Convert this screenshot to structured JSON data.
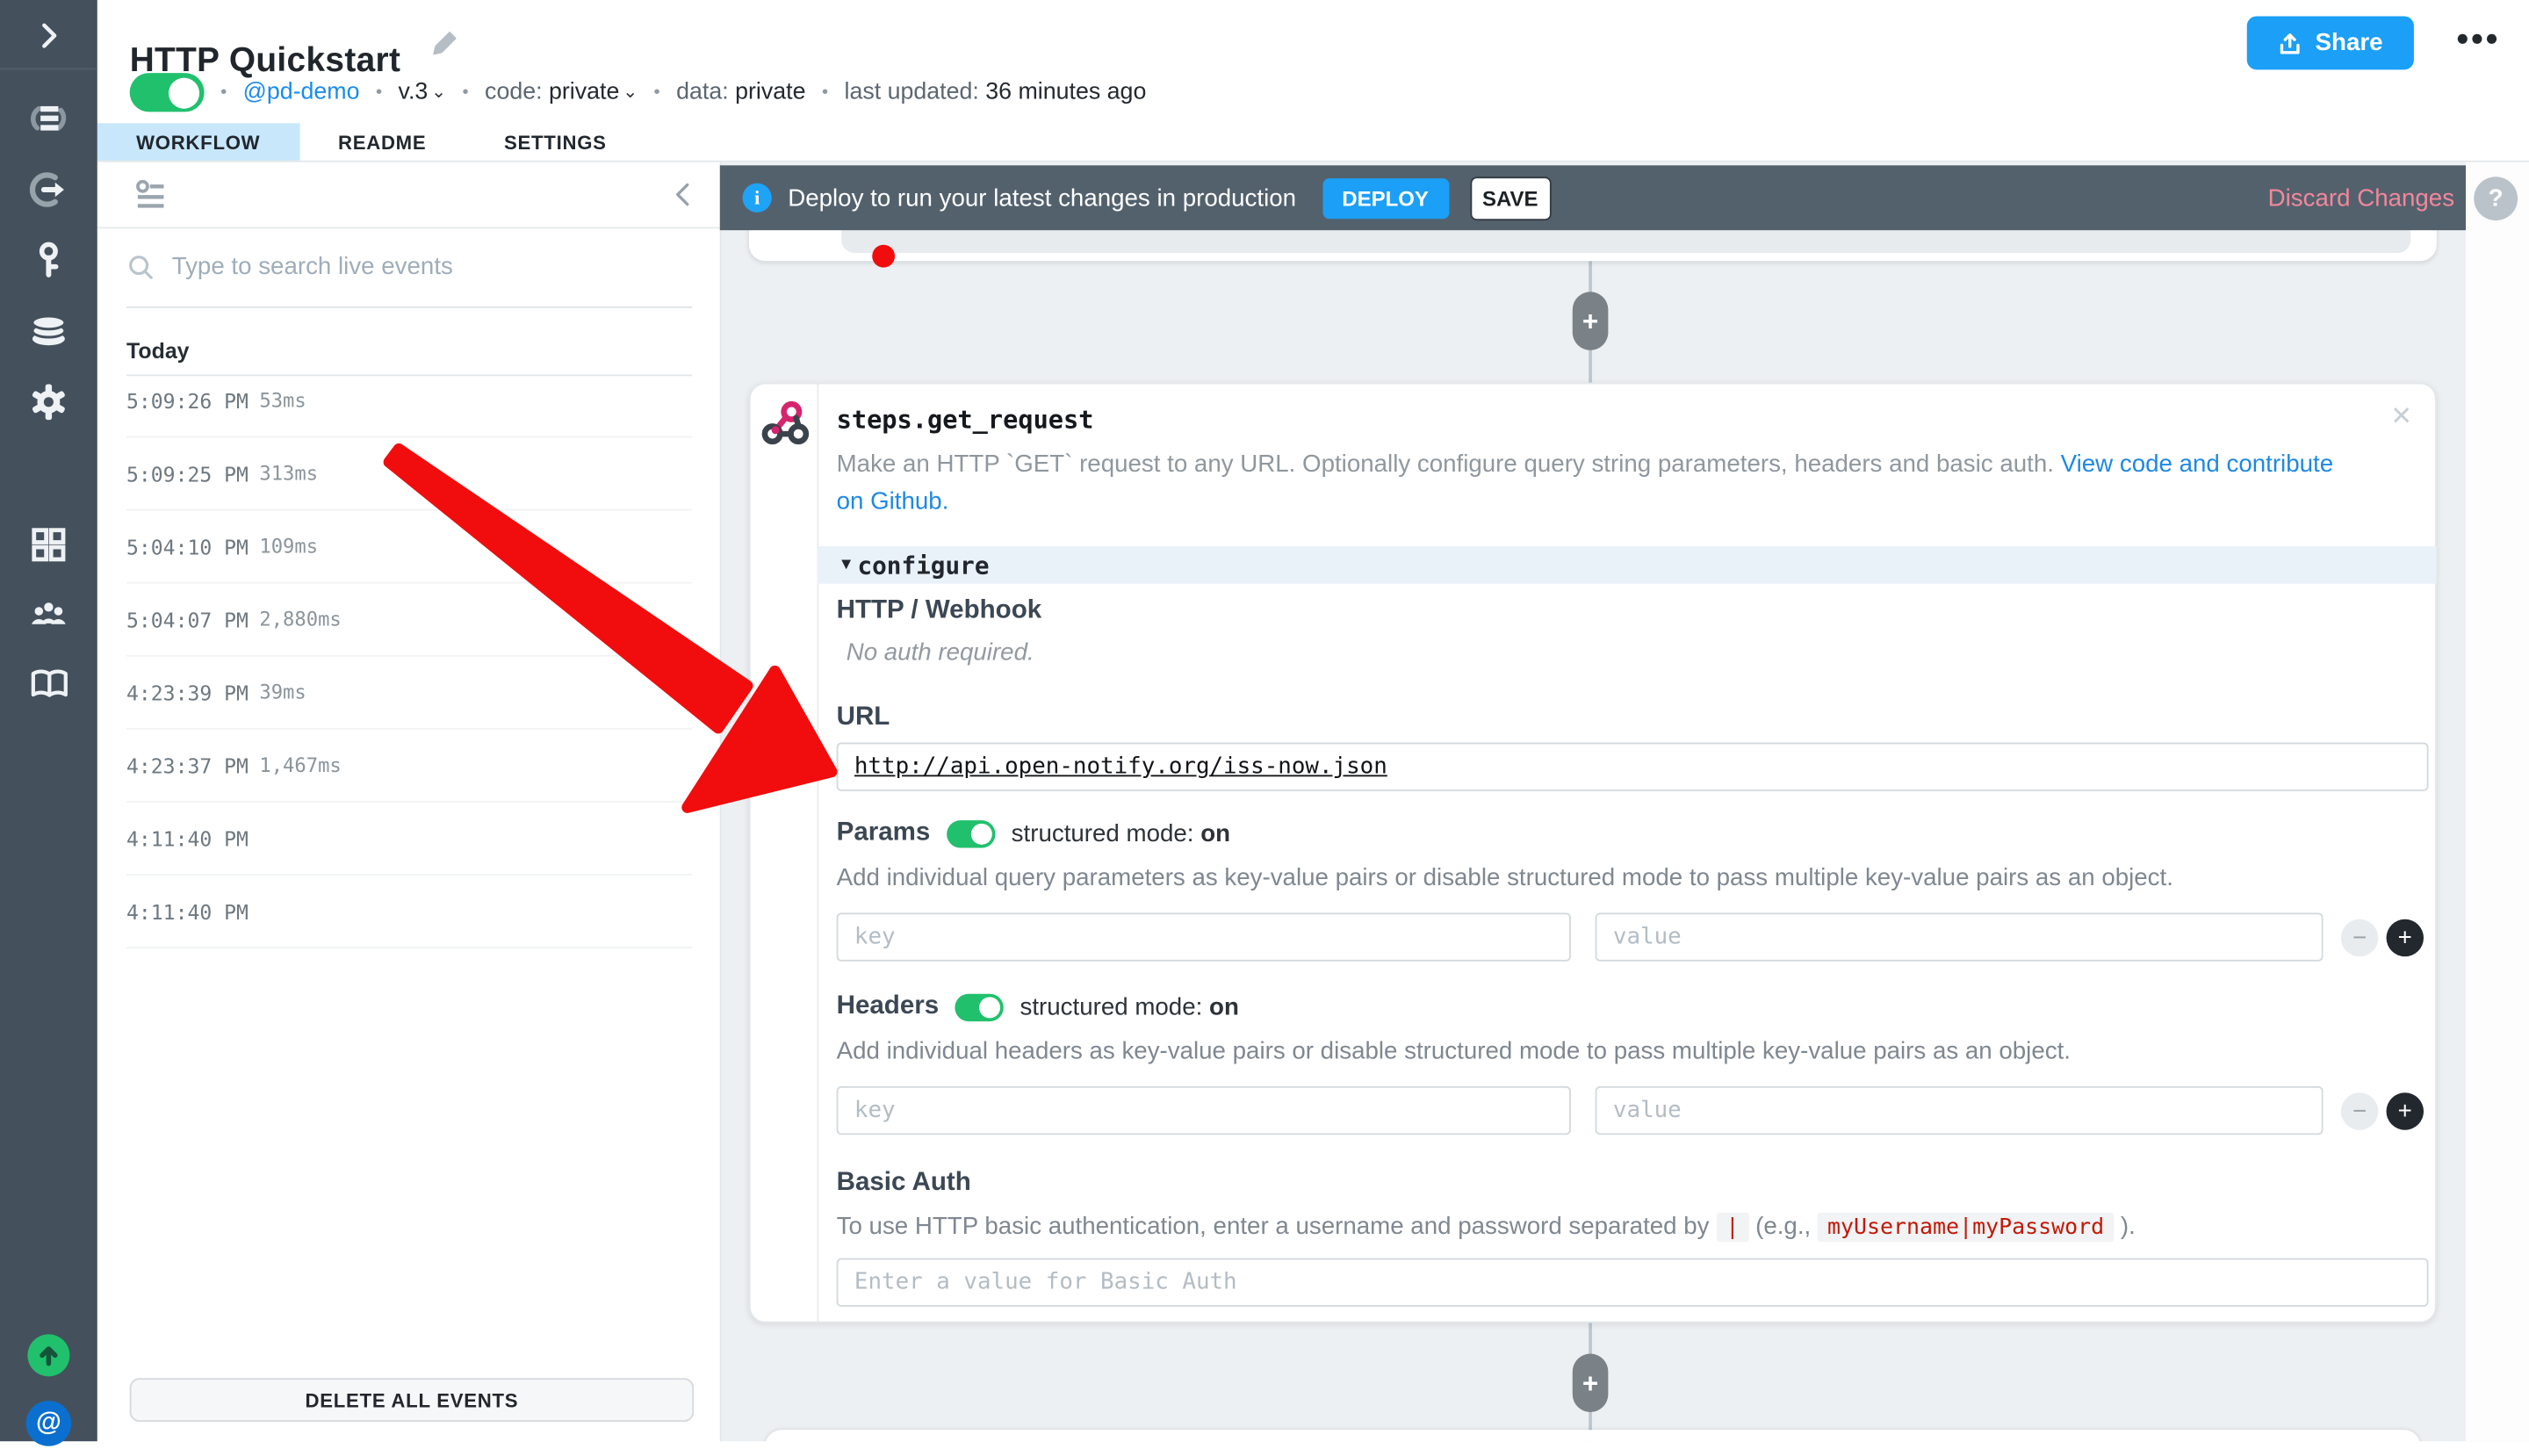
{
  "colors": {
    "accent_blue": "#1b9ff7",
    "toggle_green": "#21c06d",
    "annotation_red": "#f10d0d",
    "discard_pink": "#f2889b",
    "banner_slate": "#53616d",
    "rail_slate": "#44505c",
    "active_tab_blue": "#c8e7fb",
    "code_red": "#c21807"
  },
  "icons": [
    "expand-icon",
    "workflows-icon",
    "event-sources-icon",
    "key-icon",
    "sql-icon",
    "gear-icon",
    "apps-grid-icon",
    "community-icon",
    "docs-book-icon",
    "whats-new-icon",
    "account-at-icon",
    "pencil-icon",
    "upload-icon",
    "kebab-icon",
    "filter-icon",
    "collapse-chevron-icon",
    "search-icon",
    "info-icon",
    "webhook-icon",
    "close-icon",
    "plus-icon",
    "minus-icon",
    "help-icon"
  ],
  "header": {
    "title": "HTTP Quickstart",
    "share_label": "Share",
    "meta": {
      "separator": "•",
      "handle": "@pd-demo",
      "version": "v.3",
      "version_chevron": "⌄",
      "code_label": "code:",
      "code_value": "private",
      "code_chevron": "⌄",
      "data_label": "data:",
      "data_value": "private",
      "updated_label": "last updated:",
      "updated_value": "36 minutes ago"
    },
    "tabs": [
      {
        "label": "WORKFLOW",
        "active": true
      },
      {
        "label": "README",
        "active": false
      },
      {
        "label": "SETTINGS",
        "active": false
      }
    ]
  },
  "events_panel": {
    "search_placeholder": "Type to search live events",
    "section_label": "Today",
    "events": [
      {
        "time": "5:09:26 PM",
        "duration": "53ms"
      },
      {
        "time": "5:09:25 PM",
        "duration": "313ms"
      },
      {
        "time": "5:04:10 PM",
        "duration": "109ms"
      },
      {
        "time": "5:04:07 PM",
        "duration": "2,880ms"
      },
      {
        "time": "4:23:39 PM",
        "duration": "39ms"
      },
      {
        "time": "4:23:37 PM",
        "duration": "1,467ms"
      },
      {
        "time": "4:11:40 PM",
        "duration": ""
      },
      {
        "time": "4:11:40 PM",
        "duration": ""
      }
    ],
    "delete_button": "DELETE ALL EVENTS"
  },
  "banner": {
    "info_glyph": "i",
    "message": "Deploy to run your latest changes in production",
    "deploy_label": "DEPLOY",
    "save_label": "SAVE",
    "discard_label": "Discard Changes"
  },
  "help_label": "?",
  "controls": {
    "add_label": "+",
    "remove_label": "−",
    "close_label": "✕",
    "configure_triangle": "▼"
  },
  "step": {
    "name": "steps.get_request",
    "description": "Make an HTTP `GET` request to any URL. Optionally configure query string parameters, headers and basic auth.",
    "link_line1": "View code and contribute",
    "link_line2": "on Github.",
    "configure_label": "configure",
    "auth": {
      "title": "HTTP / Webhook",
      "note": "No auth required."
    },
    "url": {
      "label": "URL",
      "value": "http://api.open-notify.org/iss-now.json"
    },
    "params": {
      "title": "Params",
      "mode_label": "structured mode:",
      "mode_value": "on",
      "description": "Add individual query parameters as key-value pairs or disable structured mode to pass multiple key-value pairs as an object.",
      "key_placeholder": "key",
      "value_placeholder": "value"
    },
    "headers": {
      "title": "Headers",
      "mode_label": "structured mode:",
      "mode_value": "on",
      "description": "Add individual headers as key-value pairs or disable structured mode to pass multiple key-value pairs as an object.",
      "key_placeholder": "key",
      "value_placeholder": "value"
    },
    "basic_auth": {
      "title": "Basic Auth",
      "desc_1": "To use HTTP basic authentication, enter a username and password separated by",
      "code_1": "|",
      "desc_2": "(e.g.,",
      "code_2": "myUsername|myPassword",
      "desc_3": ").",
      "placeholder": "Enter a value for Basic Auth"
    }
  }
}
